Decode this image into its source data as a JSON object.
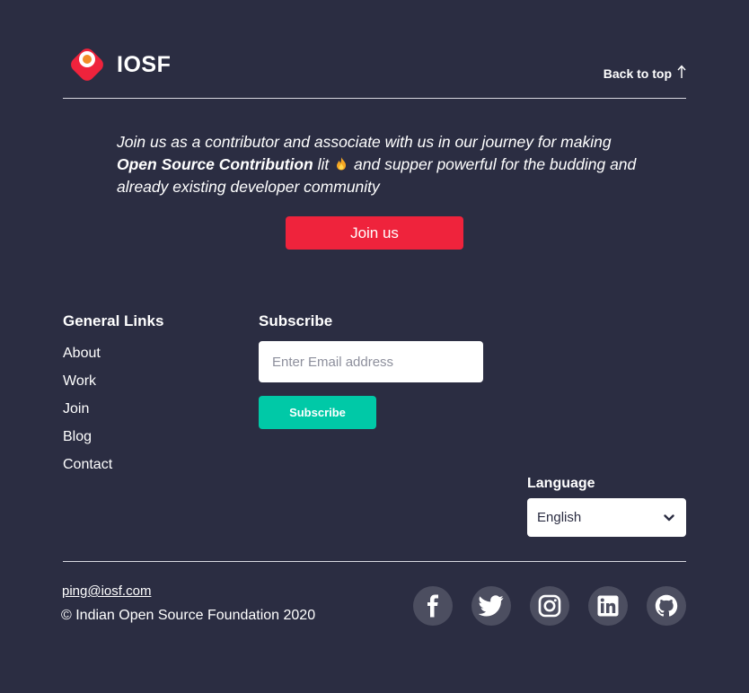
{
  "header": {
    "brand": "IOSF",
    "back_to_top": "Back to top"
  },
  "intro": {
    "line_start": "Join us as a contributor and associate with us in our journey for making",
    "bold": "Open Source Contribution",
    "lit": "lit",
    "line_end": "and supper powerful for the budding and already existing developer community",
    "join_button": "Join us"
  },
  "general_links": {
    "title": "General Links",
    "items": [
      "About",
      "Work",
      "Join",
      "Blog",
      "Contact"
    ]
  },
  "subscribe": {
    "title": "Subscribe",
    "email_placeholder": "Enter Email address",
    "button": "Subscribe"
  },
  "language": {
    "label": "Language",
    "selected": "English"
  },
  "footer": {
    "email": "ping@iosf.com",
    "copyright": "© Indian Open Source Foundation 2020",
    "socials": [
      "facebook-icon",
      "twitter-icon",
      "instagram-icon",
      "linkedin-icon",
      "github-icon"
    ]
  },
  "colors": {
    "background": "#2b2d42",
    "accent_red": "#ef233c",
    "accent_teal": "#00c9a7",
    "social_bg": "#4c4e60"
  }
}
